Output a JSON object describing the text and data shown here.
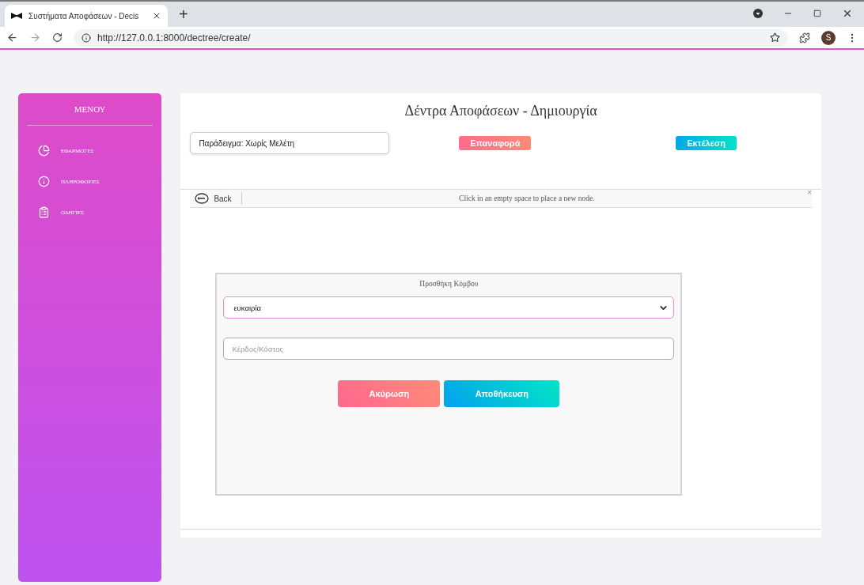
{
  "browser": {
    "tab_title": "Συστήματα Αποφάσεων - Decis",
    "new_tab": "+",
    "url": "http://127.0.0.1:8000/dectree/create/",
    "profile": "S"
  },
  "sidebar": {
    "title": "ΜΕΝΟΥ",
    "items": [
      {
        "label": "ΕΦΑΡΜΟΓΕΣ",
        "kind": "chart"
      },
      {
        "label": "ΠΛΗΡΟΦΟΡΙΕΣ",
        "kind": "info"
      },
      {
        "label": "ΟΔΗΓΙΕΣ",
        "kind": "clipboard"
      }
    ]
  },
  "main": {
    "title": "Δέντρα Αποφάσεων - Δημιουργία",
    "example_field": {
      "value": "Παράδειγμα: Χωρίς Μελέτη"
    },
    "reset_button": "Επαναφορά",
    "run_button": "Εκτέλεση"
  },
  "editor": {
    "back": "Back",
    "hint": "Click in an empty space to place a new node.",
    "close": "×"
  },
  "dialog": {
    "title": "Προσθήκη Κόμβου",
    "type_select": {
      "value": "ευκαιρία"
    },
    "amount_field": {
      "placeholder": "Κέρδος/Κόστος"
    },
    "cancel_button": "Ακύρωση",
    "save_button": "Αποθήκευση"
  }
}
